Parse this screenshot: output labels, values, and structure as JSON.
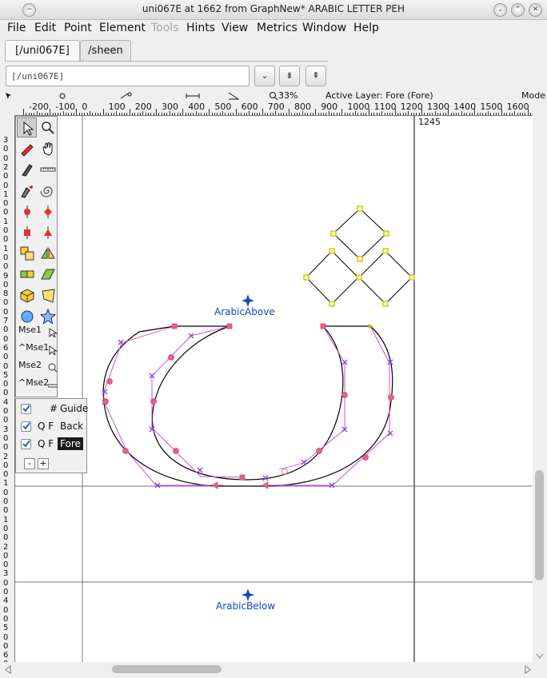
{
  "window": {
    "title": "uni067E at 1662 from GraphNew* ARABIC LETTER PEH",
    "left_button_glyph": "−",
    "buttons": [
      "⌄",
      "⌃",
      "✕"
    ]
  },
  "menu": [
    "File",
    "Edit",
    "Point",
    "Element",
    "Tools",
    "Hints",
    "View",
    "Metrics",
    "Window",
    "Help"
  ],
  "menu_disabled": [
    "Tools"
  ],
  "tabs": [
    {
      "label": "[/uni067E]",
      "active": true
    },
    {
      "label": "/sheen",
      "active": false
    }
  ],
  "glyph_field": {
    "value": "[/uni067E]"
  },
  "toolbar_buttons": {
    "dropdown": "⌄",
    "prev": "⇟",
    "next": "⇞"
  },
  "infobar": {
    "zoom": "33%",
    "active_layer": "Active Layer: Fore (Fore)",
    "mode": "Mode"
  },
  "ruler": {
    "labels": [
      "-200",
      "-100",
      "0",
      "100",
      "200",
      "300",
      "400",
      "500",
      "600",
      "700",
      "800",
      "900",
      "1000",
      "1100",
      "1200",
      "1300",
      "1400",
      "1500",
      "1600"
    ]
  },
  "vruler_labels": [
    "3",
    "0",
    "0",
    "2",
    "0",
    "0",
    "1",
    "0",
    "0",
    "1",
    "0",
    "0",
    "1",
    "0",
    "0",
    "9",
    "0",
    "8",
    "0",
    "0",
    "7",
    "0",
    "0",
    "6",
    "0",
    "0",
    "5",
    "0",
    "0",
    "4",
    "0",
    "0",
    "3",
    "0",
    "0",
    "2",
    "0",
    "0",
    "1",
    "0",
    "0",
    "0",
    "1",
    "0",
    "0",
    "2",
    "0",
    "0",
    "3",
    "0",
    "0",
    "4",
    "0",
    "0",
    "5",
    "0",
    "0",
    "6",
    "0",
    "0"
  ],
  "canvas": {
    "advance_width_label": "1245",
    "anchor_above": "ArabicAbove",
    "anchor_below": "ArabicBelow"
  },
  "tools": [
    "pointer-tool",
    "magnify-tool",
    "freehand-tool",
    "scroll-tool",
    "pen-tool",
    "ruler-tool",
    "spiro-tool",
    "spiral-tool",
    "curve-point-tool",
    "hvcurve-point-tool",
    "corner-point-tool",
    "tangent-point-tool",
    "scale-tool",
    "flip-tool",
    "rotate-tool",
    "skew-tool",
    "3d-rotate-tool",
    "perspective-tool",
    "ellipse-tool",
    "star-tool"
  ],
  "mouse_labels": [
    "Mse1",
    "^Mse1",
    "Mse2",
    "^Mse2"
  ],
  "layers": {
    "rows": [
      {
        "prefix": "#",
        "name": "Guide",
        "checked": true,
        "current": false
      },
      {
        "prefix": "Q F",
        "name": "Back",
        "checked": true,
        "current": false
      },
      {
        "prefix": "Q F",
        "name": "Fore",
        "checked": true,
        "current": true
      }
    ],
    "remove_label": "-",
    "add_label": "+"
  },
  "colors": {
    "outline": "#000000",
    "control_line": "#cc44cc",
    "control_point": "#8844cc",
    "on_curve_point": "#dd4466",
    "anchor": "#1144cc",
    "diamond_point": "#bbbb00",
    "selected_layer_bg": "#1b1b1b"
  }
}
